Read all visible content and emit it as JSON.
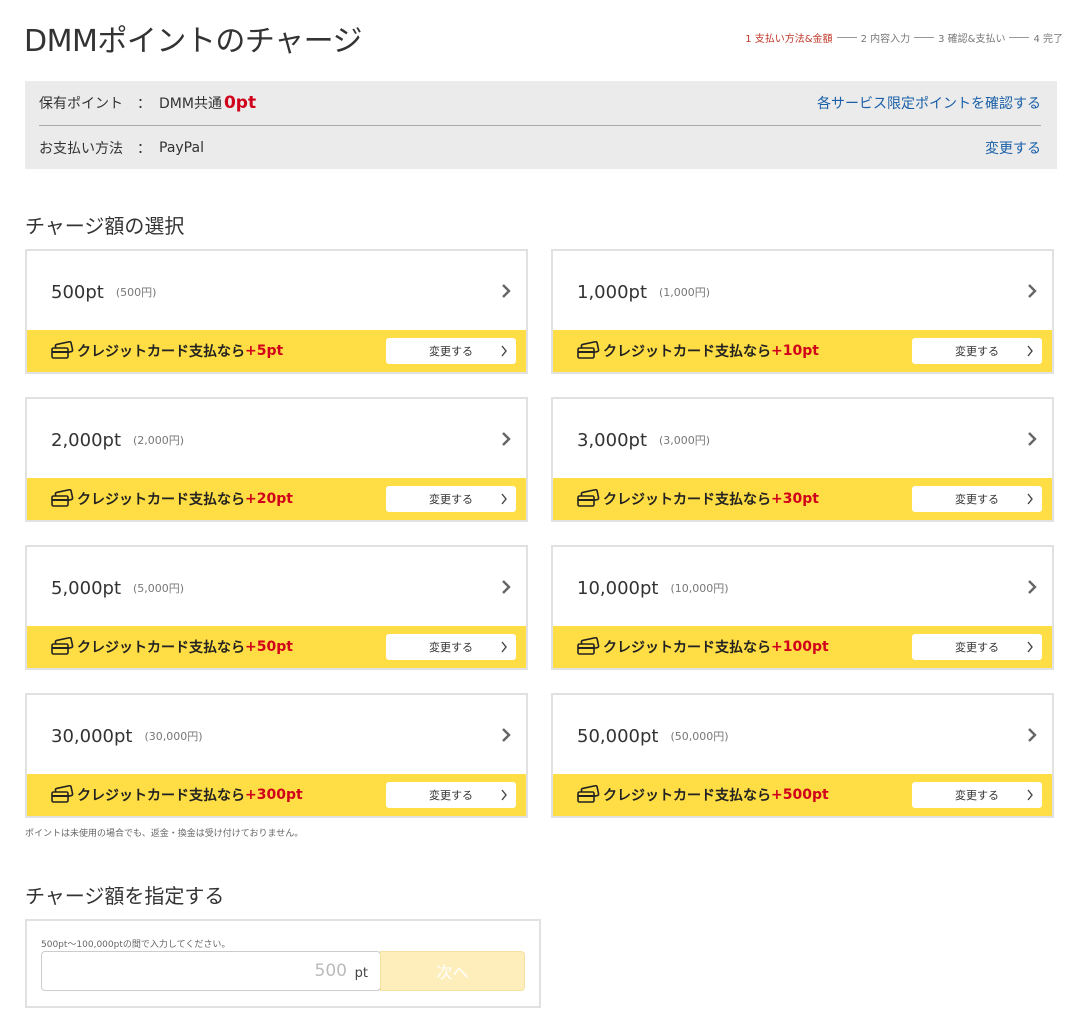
{
  "title": "DMMポイントのチャージ",
  "steps": [
    "1 支払い方法&金額",
    "2 内容入力",
    "3 確認&支払い",
    "4 完了"
  ],
  "info": {
    "points_label": "保有ポイント",
    "colon": "：",
    "points_type": "DMM共通",
    "points_value": "0pt",
    "points_link": "各サービス限定ポイントを確認する",
    "payment_label": "お支払い方法",
    "payment_value": "PayPal",
    "payment_link": "変更する"
  },
  "select_title": "チャージ額の選択",
  "cards": [
    {
      "amount": "500pt",
      "yen": "(500円)",
      "cc_text": "クレジットカード支払なら",
      "bonus": "+5pt",
      "button": "変更する"
    },
    {
      "amount": "1,000pt",
      "yen": "(1,000円)",
      "cc_text": "クレジットカード支払なら",
      "bonus": "+10pt",
      "button": "変更する"
    },
    {
      "amount": "2,000pt",
      "yen": "(2,000円)",
      "cc_text": "クレジットカード支払なら",
      "bonus": "+20pt",
      "button": "変更する"
    },
    {
      "amount": "3,000pt",
      "yen": "(3,000円)",
      "cc_text": "クレジットカード支払なら",
      "bonus": "+30pt",
      "button": "変更する"
    },
    {
      "amount": "5,000pt",
      "yen": "(5,000円)",
      "cc_text": "クレジットカード支払なら",
      "bonus": "+50pt",
      "button": "変更する"
    },
    {
      "amount": "10,000pt",
      "yen": "(10,000円)",
      "cc_text": "クレジットカード支払なら",
      "bonus": "+100pt",
      "button": "変更する"
    },
    {
      "amount": "30,000pt",
      "yen": "(30,000円)",
      "cc_text": "クレジットカード支払なら",
      "bonus": "+300pt",
      "button": "変更する"
    },
    {
      "amount": "50,000pt",
      "yen": "(50,000円)",
      "cc_text": "クレジットカード支払なら",
      "bonus": "+500pt",
      "button": "変更する"
    }
  ],
  "note": "ポイントは未使用の場合でも、返金・換金は受け付けておりません。",
  "custom_title": "チャージ額を指定する",
  "custom": {
    "hint": "500pt〜100,000ptの間で入力してください。",
    "placeholder": "500",
    "unit": "pt",
    "next_label": "次へ"
  },
  "colors": {
    "accent_yellow": "#ffdd44",
    "bonus_red": "#d0021b",
    "link_blue": "#1a5fa8",
    "step_active": "#c0392b"
  }
}
